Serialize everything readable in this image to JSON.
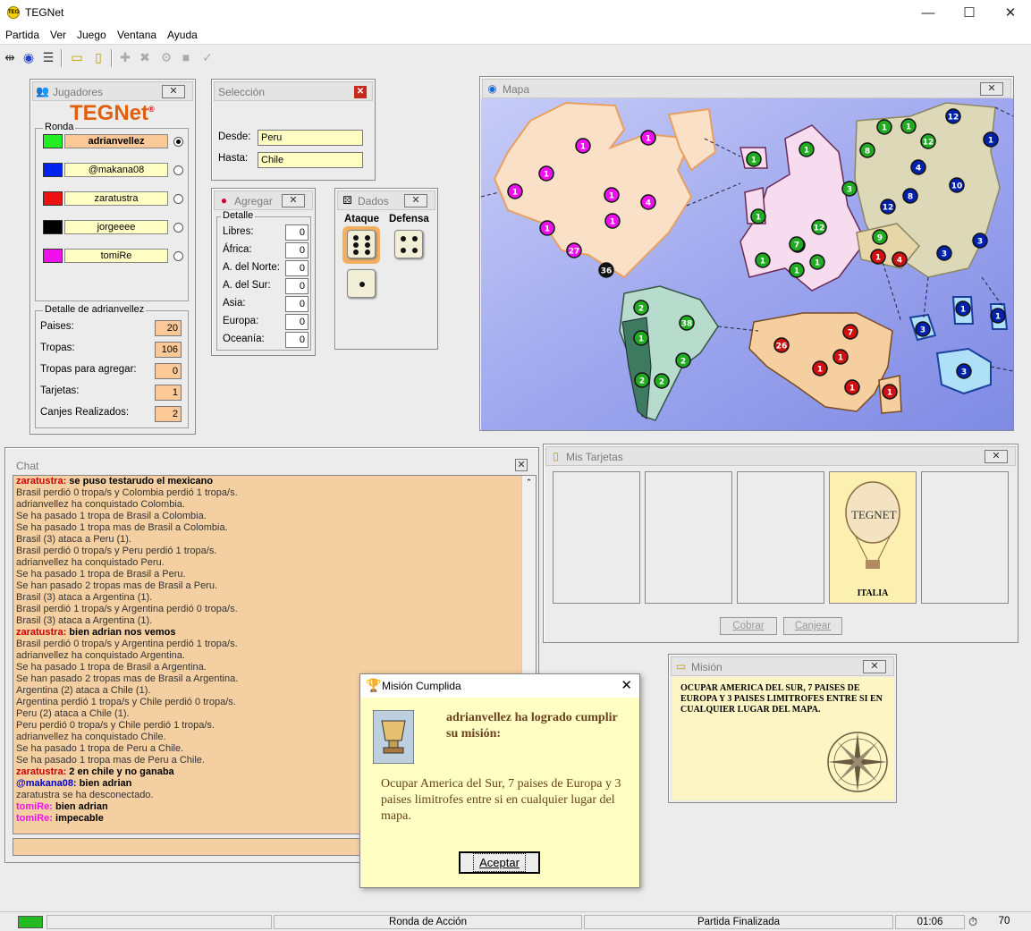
{
  "app": {
    "title": "TEGNet"
  },
  "menu": [
    "Partida",
    "Ver",
    "Juego",
    "Ventana",
    "Ayuda"
  ],
  "jugadores": {
    "title": "Jugadores",
    "logo_text": "TEGNet",
    "ronda_label": "Ronda",
    "players": [
      {
        "name": "adrianvellez",
        "color": "#22ee22",
        "active": true,
        "bg": "#fbc897"
      },
      {
        "name": "@makana08",
        "color": "#0022ee",
        "active": false,
        "bg": "#ffffc4"
      },
      {
        "name": "zaratustra",
        "color": "#ee1111",
        "active": false,
        "bg": "#ffffc4"
      },
      {
        "name": "jorgeeee",
        "color": "#000000",
        "active": false,
        "bg": "#ffffc4"
      },
      {
        "name": "tomiRe",
        "color": "#ee11ee",
        "active": false,
        "bg": "#ffffc4"
      }
    ],
    "detalle_title": "Detalle de adrianvellez",
    "detalle": [
      {
        "label": "Paises:",
        "value": "20"
      },
      {
        "label": "Tropas:",
        "value": "106"
      },
      {
        "label": "Tropas para agregar:",
        "value": "0"
      },
      {
        "label": "Tarjetas:",
        "value": "1"
      },
      {
        "label": "Canjes Realizados:",
        "value": "2"
      }
    ]
  },
  "seleccion": {
    "title": "Selección",
    "desde_label": "Desde:",
    "desde": "Peru",
    "hasta_label": "Hasta:",
    "hasta": "Chile"
  },
  "agregar": {
    "title": "Agregar",
    "detalle_label": "Detalle",
    "rows": [
      {
        "label": "Libres:",
        "value": "0"
      },
      {
        "label": "África:",
        "value": "0"
      },
      {
        "label": "A. del Norte:",
        "value": "0"
      },
      {
        "label": "A. del Sur:",
        "value": "0"
      },
      {
        "label": "Asia:",
        "value": "0"
      },
      {
        "label": "Europa:",
        "value": "0"
      },
      {
        "label": "Oceanía:",
        "value": "0"
      }
    ]
  },
  "dados": {
    "title": "Dados",
    "ataque": "Ataque",
    "defensa": "Defensa",
    "attack_dice": [
      6,
      1
    ],
    "defense_dice": [
      4
    ]
  },
  "mapa": {
    "title": "Mapa",
    "armies": [
      {
        "n": "1",
        "c": "#ee11ee"
      },
      {
        "n": "1",
        "c": "#ee11ee"
      },
      {
        "n": "1",
        "c": "#ee11ee"
      },
      {
        "n": "1",
        "c": "#ee11ee"
      },
      {
        "n": "1",
        "c": "#ee11ee"
      },
      {
        "n": "4",
        "c": "#ee11ee"
      },
      {
        "n": "1",
        "c": "#ee11ee"
      },
      {
        "n": "1",
        "c": "#ee11ee"
      },
      {
        "n": "27",
        "c": "#ee11ee"
      },
      {
        "n": "36",
        "c": "#111111"
      },
      {
        "n": "2",
        "c": "#22aa22"
      },
      {
        "n": "38",
        "c": "#22aa22"
      },
      {
        "n": "1",
        "c": "#22aa22"
      },
      {
        "n": "2",
        "c": "#22aa22"
      },
      {
        "n": "2",
        "c": "#22aa22"
      },
      {
        "n": "2",
        "c": "#22aa22"
      },
      {
        "n": "1",
        "c": "#22aa22"
      },
      {
        "n": "1",
        "c": "#22aa22"
      },
      {
        "n": "1",
        "c": "#22aa22"
      },
      {
        "n": "3",
        "c": "#22aa22"
      },
      {
        "n": "1",
        "c": "#22aa22"
      },
      {
        "n": "1",
        "c": "#22aa22"
      },
      {
        "n": "12",
        "c": "#22aa22"
      },
      {
        "n": "7",
        "c": "#22aa22"
      },
      {
        "n": "1",
        "c": "#22aa22"
      },
      {
        "n": "1",
        "c": "#22aa22"
      },
      {
        "n": "1",
        "c": "#22aa22"
      },
      {
        "n": "1",
        "c": "#22aa22"
      },
      {
        "n": "12",
        "c": "#22aa22"
      },
      {
        "n": "8",
        "c": "#22aa22"
      },
      {
        "n": "9",
        "c": "#22aa22"
      },
      {
        "n": "12",
        "c": "#0022aa"
      },
      {
        "n": "1",
        "c": "#0022aa"
      },
      {
        "n": "4",
        "c": "#0022aa"
      },
      {
        "n": "8",
        "c": "#0022aa"
      },
      {
        "n": "10",
        "c": "#0022aa"
      },
      {
        "n": "12",
        "c": "#0022aa"
      },
      {
        "n": "3",
        "c": "#0022aa"
      },
      {
        "n": "3",
        "c": "#0022aa"
      },
      {
        "n": "1",
        "c": "#0022aa"
      },
      {
        "n": "1",
        "c": "#0022aa"
      },
      {
        "n": "3",
        "c": "#0022aa"
      },
      {
        "n": "3",
        "c": "#0022aa"
      },
      {
        "n": "1",
        "c": "#cc1111"
      },
      {
        "n": "4",
        "c": "#cc1111"
      },
      {
        "n": "26",
        "c": "#cc1111"
      },
      {
        "n": "7",
        "c": "#cc1111"
      },
      {
        "n": "1",
        "c": "#cc1111"
      },
      {
        "n": "1",
        "c": "#cc1111"
      },
      {
        "n": "1",
        "c": "#cc1111"
      },
      {
        "n": "1",
        "c": "#cc1111"
      }
    ]
  },
  "chat": {
    "title": "Chat",
    "lines": [
      {
        "nick": "zaratustra:",
        "nick_color": "#cc0000",
        "text": " se puso testarudo el mexicano",
        "bold": true
      },
      {
        "text": "Brasil perdió 0 tropa/s y Colombia perdió 1 tropa/s."
      },
      {
        "text": "adrianvellez ha conquistado Colombia."
      },
      {
        "text": "Se ha pasado 1 tropa de Brasil a Colombia."
      },
      {
        "text": "Se ha pasado 1 tropa mas de Brasil a Colombia."
      },
      {
        "text": "Brasil (3) ataca a Peru (1)."
      },
      {
        "text": "Brasil perdió 0 tropa/s y Peru perdió 1 tropa/s."
      },
      {
        "text": "adrianvellez ha conquistado Peru."
      },
      {
        "text": "Se ha pasado 1 tropa de Brasil a Peru."
      },
      {
        "text": "Se han pasado 2 tropas mas de Brasil a Peru."
      },
      {
        "text": "Brasil (3) ataca a Argentina (1)."
      },
      {
        "text": "Brasil perdió 1 tropa/s y Argentina perdió 0 tropa/s."
      },
      {
        "text": "Brasil (3) ataca a Argentina (1)."
      },
      {
        "nick": "zaratustra:",
        "nick_color": "#cc0000",
        "text": " bien adrian nos vemos",
        "bold": true
      },
      {
        "text": "Brasil perdió 0 tropa/s y Argentina perdió 1 tropa/s."
      },
      {
        "text": "adrianvellez ha conquistado Argentina."
      },
      {
        "text": "Se ha pasado 1 tropa de Brasil a Argentina."
      },
      {
        "text": "Se han pasado 2 tropas mas de Brasil a Argentina."
      },
      {
        "text": "Argentina (2) ataca a Chile (1)."
      },
      {
        "text": "Argentina perdió 1 tropa/s y Chile perdió 0 tropa/s."
      },
      {
        "text": "Peru (2) ataca a Chile (1)."
      },
      {
        "text": "Peru perdió 0 tropa/s y Chile perdió 1 tropa/s."
      },
      {
        "text": "adrianvellez ha conquistado Chile."
      },
      {
        "text": "Se ha pasado 1 tropa de Peru a Chile."
      },
      {
        "text": "Se ha pasado 1 tropa mas de Peru a Chile."
      },
      {
        "nick": "zaratustra:",
        "nick_color": "#cc0000",
        "text": " 2 en chile y no ganaba",
        "bold": true
      },
      {
        "nick": "@makana08:",
        "nick_color": "#0000cc",
        "text": " bien adrian",
        "bold": true
      },
      {
        "text": "zaratustra se ha desconectado."
      },
      {
        "nick": "tomiRe:",
        "nick_color": "#ee11ee",
        "text": " bien adrian",
        "bold": true
      },
      {
        "nick": "tomiRe:",
        "nick_color": "#ee11ee",
        "text": " impecable",
        "bold": true
      }
    ]
  },
  "tarjetas": {
    "title": "Mis Tarjetas",
    "card_logo": "TEGNET",
    "card_country": "ITALIA",
    "cobrar": "Cobrar",
    "canjear": "Canjear"
  },
  "mision": {
    "title": "Misión",
    "text": "OCUPAR AMERICA DEL SUR, 7 PAISES DE EUROPA Y 3 PAISES LIMITROFES ENTRE SI EN CUALQUIER LUGAR DEL MAPA."
  },
  "dialog": {
    "title": "Misión Cumplida",
    "headline": "adrianvellez ha logrado cumplir su misión:",
    "body": "Ocupar America del Sur, 7 paises de Europa y 3 paises limitrofes entre si en cualquier lugar del mapa.",
    "button": "Aceptar"
  },
  "status": {
    "ronda": "Ronda de Acción",
    "estado": "Partida Finalizada",
    "time": "01:06",
    "count": "70",
    "indicator_color": "#22bb22"
  }
}
